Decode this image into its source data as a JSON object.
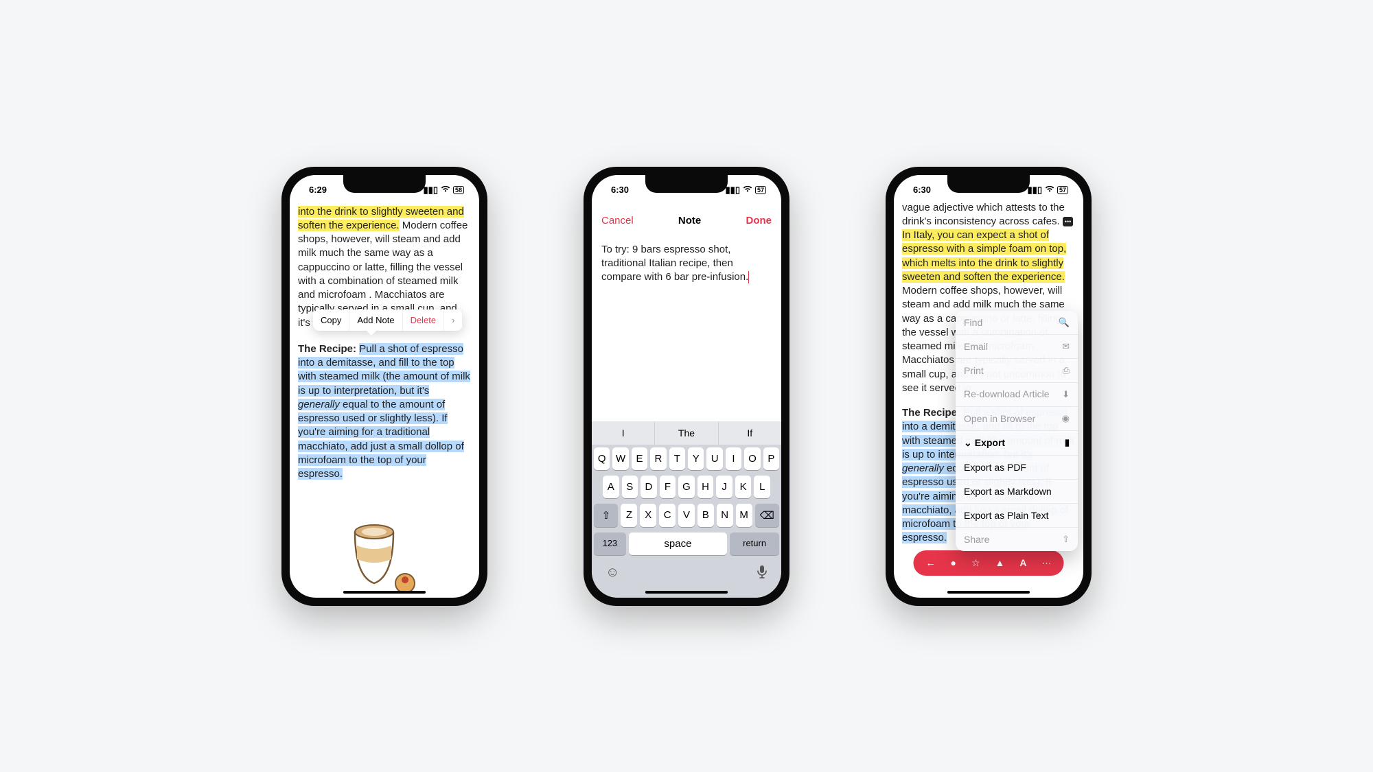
{
  "phone1": {
    "status": {
      "time": "6:29",
      "battery": "58"
    },
    "text": {
      "hl1": "into the drink to slightly sweeten and soften the experience.",
      "body1": " Modern coffee shops, however, will steam and add milk much the same way as a cappuccino or latte, filling the vessel with a combination of steamed milk and microfoam . Macchiatos are typically served in a small cup, and it's not uncommon to see it ser",
      "bold": "The Recipe: ",
      "hl2": "Pull a shot of espresso into a demitasse, and fill to the top with steamed milk (the amount of milk is up to interpretation, but it's ",
      "hl2_italic": "generally",
      "hl2_rest": " equal to the amount of espresso used or slightly less). If you're aiming for a traditional macchiato, add just a small dollop of microfoam to the top of your espresso."
    },
    "context_menu": {
      "copy": "Copy",
      "add_note": "Add Note",
      "delete": "Delete"
    }
  },
  "phone2": {
    "status": {
      "time": "6:30",
      "battery": "57"
    },
    "modal": {
      "cancel": "Cancel",
      "title": "Note",
      "done": "Done"
    },
    "note_text": "To try: 9 bars espresso shot, traditional Italian recipe, then compare with 6 bar pre-infusion.",
    "predictions": {
      "a": "I",
      "b": "The",
      "c": "If"
    },
    "keyboard": {
      "row1": [
        "Q",
        "W",
        "E",
        "R",
        "T",
        "Y",
        "U",
        "I",
        "O",
        "P"
      ],
      "row2": [
        "A",
        "S",
        "D",
        "F",
        "G",
        "H",
        "J",
        "K",
        "L"
      ],
      "row3": [
        "Z",
        "X",
        "C",
        "V",
        "B",
        "N",
        "M"
      ],
      "num": "123",
      "space": "space",
      "ret": "return"
    }
  },
  "phone3": {
    "status": {
      "time": "6:30",
      "battery": "57"
    },
    "text": {
      "pre": "vague adjective which attests to the drink's inconsistency across cafes. ",
      "hl1": " In Italy, you can expect a shot of espresso with a simple foam on top, which melts into the drink to slightly sweeten and soften the experience.",
      "body1": " Modern coffee shops, however, will steam and add milk much the same way as a cappuccino or latte, filling the vessel with a combination of steamed milk and microfoam . Macchiatos are typically served in a small cup, and it's not uncommon to see it served in",
      "bold": "The Recipe: ",
      "hl2": "Pull a shot of espresso into a demitasse, and fill to the top with steamed milk (the amount of milk is up to interpretation, but it's ",
      "hl2_italic": "generally",
      "hl2_rest": " equal to the amount of espresso used or slightly less). If you're aiming for a traditional macchiato, add just a small dollop of microfoam to the top of your espresso."
    },
    "menu": {
      "find": "Find",
      "email": "Email",
      "print": "Print",
      "redownload": "Re-download Article",
      "open": "Open in Browser",
      "export": "Export",
      "pdf": "Export as PDF",
      "md": "Export as Markdown",
      "txt": "Export as Plain Text",
      "share": "Share"
    }
  }
}
